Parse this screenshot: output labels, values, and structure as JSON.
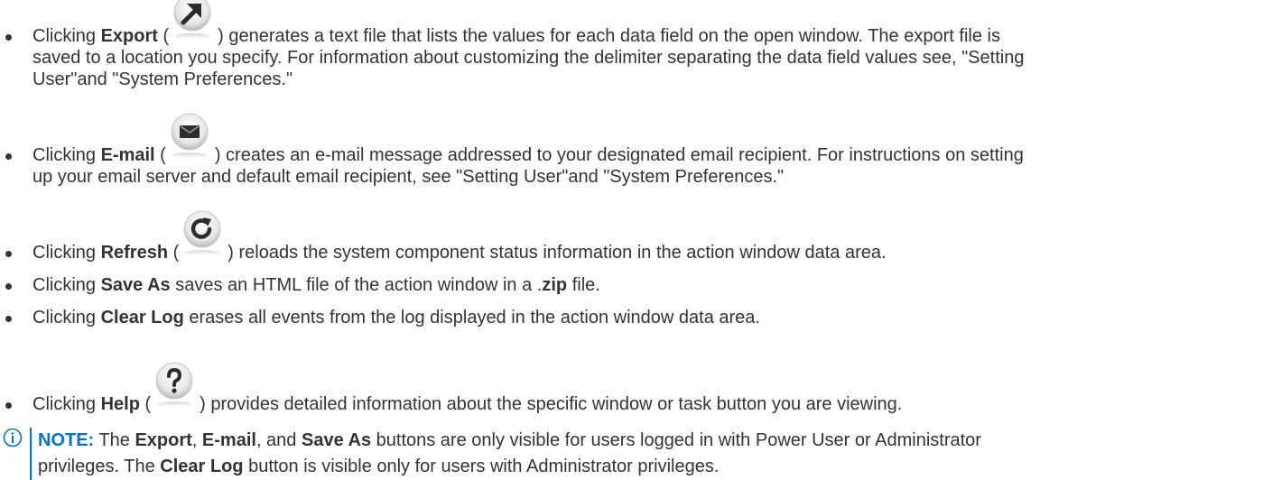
{
  "colors": {
    "text": "#333333",
    "note_accent": "#0672cb"
  },
  "bullets": [
    {
      "icon": "arrow-up-right-icon",
      "line1_pre": "Clicking ",
      "label": "Export",
      "line1_mid": " (",
      "line1_post": ") generates a text file that lists the values for each data field on the open window. The export file is",
      "line2": "saved to a location you specify. For information about customizing the delimiter separating the data field values see, \"Setting",
      "line3": "User\"and \"System Preferences.\""
    },
    {
      "icon": "envelope-icon",
      "line1_pre": "Clicking ",
      "label": "E-mail",
      "line1_mid": " (",
      "line1_post": ") creates an e-mail message addressed to your designated email recipient. For instructions on setting",
      "line2": "up your email server and default email recipient, see \"Setting User\"and \"System Preferences.\""
    },
    {
      "icon": "refresh-icon",
      "line1_pre": "Clicking ",
      "label": "Refresh",
      "line1_mid": " (",
      "line1_post": ") reloads the system component status information in the action window data area."
    },
    {
      "line1_pre": "Clicking ",
      "label": "Save As",
      "line1_post": " saves an HTML file of the action window in a .",
      "bold2": "zip",
      "line1_tail": " file."
    },
    {
      "line1_pre": "Clicking ",
      "label": "Clear Log",
      "line1_post": " erases all events from the log displayed in the action window data area."
    },
    {
      "icon": "help-question-icon",
      "line1_pre": "Clicking ",
      "label": "Help",
      "line1_mid": " (",
      "line1_post": ") provides detailed information about the specific window or task button you are viewing."
    }
  ],
  "note": {
    "label": "NOTE:",
    "t1": " The ",
    "b1": "Export",
    "t2": ", ",
    "b2": "E-mail",
    "t3": ", and ",
    "b3": "Save As",
    "t4": " buttons are only visible for users logged in with Power User or Administrator",
    "t5": "privileges. The ",
    "b4": "Clear Log",
    "t6": " button is visible only for users with Administrator privileges."
  }
}
